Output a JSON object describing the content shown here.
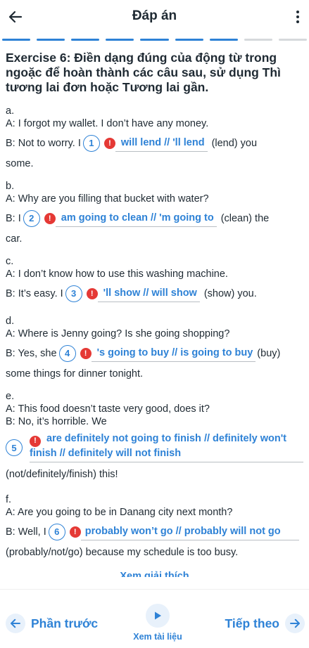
{
  "header": {
    "title": "Đáp án"
  },
  "progress": {
    "total": 9,
    "active": 7
  },
  "exercise": {
    "title": "Exercise 6: Điền dạng đúng của động từ trong ngoặc để hoàn thành các câu sau, sử dụng Thì tương lai đơn hoặc Tương lai gần."
  },
  "questions": [
    {
      "letter": "a.",
      "a_line": "A: I forgot my wallet. I don’t have any money.",
      "b_prefix": "B: Not to worry. I",
      "num": "1",
      "answer": "will lend // 'll lend",
      "b_suffix": "(lend) you",
      "continuation": "some."
    },
    {
      "letter": "b.",
      "a_line": "A: Why are you filling that bucket with water?",
      "b_prefix": "B: I",
      "num": "2",
      "answer": "am going to clean // 'm going to",
      "b_suffix": "(clean) the",
      "continuation": "car."
    },
    {
      "letter": "c.",
      "a_line": "A: I don’t know how to use this washing machine.",
      "b_prefix": "B: It’s easy. I",
      "num": "3",
      "answer": "'ll show // will show",
      "b_suffix": "(show) you.",
      "continuation": ""
    },
    {
      "letter": "d.",
      "a_line": "A: Where is Jenny going? Is she going shopping?",
      "b_prefix": "B: Yes, she",
      "num": "4",
      "answer": "'s going to buy // is going to buy",
      "b_suffix": "(buy)",
      "continuation": "some things for dinner tonight."
    },
    {
      "letter": "e.",
      "a_line": "A: This food doesn’t taste very good, does it?",
      "b_prefix": "B: No, it’s horrible. We",
      "num": "5",
      "answer": "are definitely not going to finish // definitely won't finish // definitely will not finish",
      "b_suffix": "",
      "continuation": "(not/definitely/finish) this!"
    },
    {
      "letter": "f.",
      "a_line": "A: Are you going to be in Danang city next month?",
      "b_prefix": "B: Well, I",
      "num": "6",
      "answer": "probably won’t go // probably will not go",
      "b_suffix": "",
      "continuation": "(probably/not/go) because my schedule is too busy."
    }
  ],
  "see_more": "Xem giải thích",
  "footer": {
    "prev_label": "Phần trước",
    "doc_label": "Xem tài liệu",
    "next_label": "Tiếp theo"
  },
  "colors": {
    "accent": "#2e82d6",
    "error": "#e53935",
    "text": "#1f2a33"
  },
  "icons": [
    "back-arrow-icon",
    "more-vertical-icon",
    "error-icon",
    "play-icon",
    "arrow-left-icon",
    "arrow-right-icon"
  ]
}
